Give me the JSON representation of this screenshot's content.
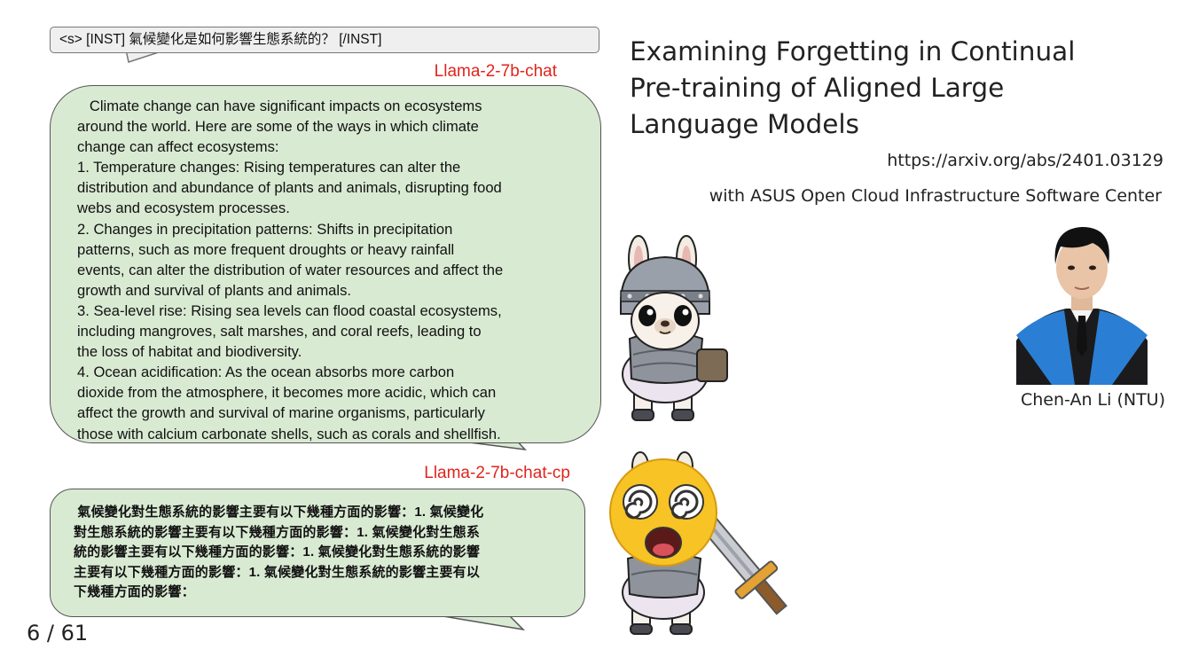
{
  "prompt": "<s> [INST] 氣候變化是如何影響生態系統的？ [/INST]",
  "model_a_label": "Llama-2-7b-chat",
  "model_a_response": [
    "   Climate change can have significant impacts on ecosystems",
    "around the world. Here are some of the ways in which climate",
    "change can affect ecosystems:",
    "1. Temperature changes: Rising temperatures can alter the",
    "distribution and abundance of plants and animals, disrupting food",
    "webs and ecosystem processes.",
    "2. Changes in precipitation patterns: Shifts in precipitation",
    "patterns, such as more frequent droughts or heavy rainfall",
    "events, can alter the distribution of water resources and affect the",
    "growth and survival of plants and animals.",
    "3. Sea-level rise: Rising sea levels can flood coastal ecosystems,",
    "including mangroves, salt marshes, and coral reefs, leading to",
    "the loss of habitat and biodiversity.",
    "4. Ocean acidification: As the ocean absorbs more carbon",
    "dioxide from the atmosphere, it becomes more acidic, which can",
    "affect the growth and survival of marine organisms, particularly",
    "those with calcium carbonate shells, such as corals and shellfish."
  ],
  "model_b_label": "Llama-2-7b-chat-cp",
  "model_b_response": [
    " 氣候變化對生態系統的影響主要有以下幾種方面的影響：1. 氣候變化",
    "對生態系統的影響主要有以下幾種方面的影響：1. 氣候變化對生態系",
    "統的影響主要有以下幾種方面的影響：1. 氣候變化對生態系統的影響",
    "主要有以下幾種方面的影響：1. 氣候變化對生態系統的影響主要有以",
    "下幾種方面的影響："
  ],
  "title_lines": [
    "Examining Forgetting in Continual",
    "Pre-training of Aligned Large",
    "Language Models"
  ],
  "url": "https://arxiv.org/abs/2401.03129",
  "affiliation": "with ASUS Open Cloud Infrastructure Software Center",
  "presenter": "Chen-An Li (NTU)",
  "slide_number": "6 / 61",
  "colors": {
    "bubble_fill": "#d9ead3",
    "model_label": "#e0241c",
    "prompt_fill": "#efefef"
  }
}
